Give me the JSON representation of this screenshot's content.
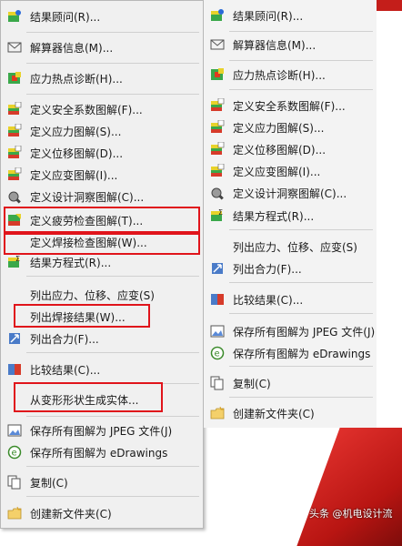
{
  "left_menu": {
    "items": [
      {
        "label": "结果顾问(R)...",
        "icon": "results-advisor-icon"
      },
      {
        "label": "解算器信息(M)...",
        "icon": "envelope-icon"
      },
      {
        "label": "应力热点诊断(H)...",
        "icon": "hotspot-icon"
      },
      {
        "label": "定义安全系数图解(F)...",
        "icon": "factor-of-safety-icon"
      },
      {
        "label": "定义应力图解(S)...",
        "icon": "stress-plot-icon"
      },
      {
        "label": "定义位移图解(D)...",
        "icon": "displacement-plot-icon"
      },
      {
        "label": "定义应变图解(I)...",
        "icon": "strain-plot-icon"
      },
      {
        "label": "定义设计洞察图解(C)...",
        "icon": "design-insight-icon"
      },
      {
        "label": "定义疲劳检查图解(T)...",
        "icon": "fatigue-check-icon"
      },
      {
        "label": "定义焊接检查图解(W)...",
        "icon": ""
      },
      {
        "label": "结果方程式(R)...",
        "icon": "result-equation-icon"
      },
      {
        "label": "列出应力、位移、应变(S)",
        "icon": ""
      },
      {
        "label": "列出焊接结果(W)...",
        "icon": ""
      },
      {
        "label": "列出合力(F)...",
        "icon": "resultant-force-icon"
      },
      {
        "label": "比较结果(C)...",
        "icon": "compare-results-icon"
      },
      {
        "label": "从变形形状生成实体...",
        "icon": ""
      },
      {
        "label": "保存所有图解为 JPEG 文件(J)",
        "icon": "save-jpeg-icon"
      },
      {
        "label": "保存所有图解为 eDrawings",
        "icon": "edrawings-icon"
      },
      {
        "label": "复制(C)",
        "icon": "copy-icon"
      },
      {
        "label": "创建新文件夹(C)",
        "icon": "new-folder-icon"
      }
    ]
  },
  "right_menu": {
    "header_partial": "...",
    "items": [
      {
        "label": "结果顾问(R)...",
        "icon": "results-advisor-icon"
      },
      {
        "label": "解算器信息(M)...",
        "icon": "envelope-icon"
      },
      {
        "label": "应力热点诊断(H)...",
        "icon": "hotspot-icon"
      },
      {
        "label": "定义安全系数图解(F)...",
        "icon": "factor-of-safety-icon"
      },
      {
        "label": "定义应力图解(S)...",
        "icon": "stress-plot-icon"
      },
      {
        "label": "定义位移图解(D)...",
        "icon": "displacement-plot-icon"
      },
      {
        "label": "定义应变图解(I)...",
        "icon": "strain-plot-icon"
      },
      {
        "label": "定义设计洞察图解(C)...",
        "icon": "design-insight-icon"
      },
      {
        "label": "结果方程式(R)...",
        "icon": "result-equation-icon"
      },
      {
        "label": "列出应力、位移、应变(S)",
        "icon": ""
      },
      {
        "label": "列出合力(F)...",
        "icon": "resultant-force-icon"
      },
      {
        "label": "比较结果(C)...",
        "icon": "compare-results-icon"
      },
      {
        "label": "保存所有图解为 JPEG 文件(J)",
        "icon": "save-jpeg-icon"
      },
      {
        "label": "保存所有图解为 eDrawings",
        "icon": "edrawings-icon"
      },
      {
        "label": "复制(C)",
        "icon": "copy-icon"
      },
      {
        "label": "创建新文件夹(C)",
        "icon": "new-folder-icon"
      }
    ]
  },
  "watermark": "头条 @机电设计流",
  "colors": {
    "highlight": "#e0141b",
    "menu_bg": "#f0f0f0"
  }
}
